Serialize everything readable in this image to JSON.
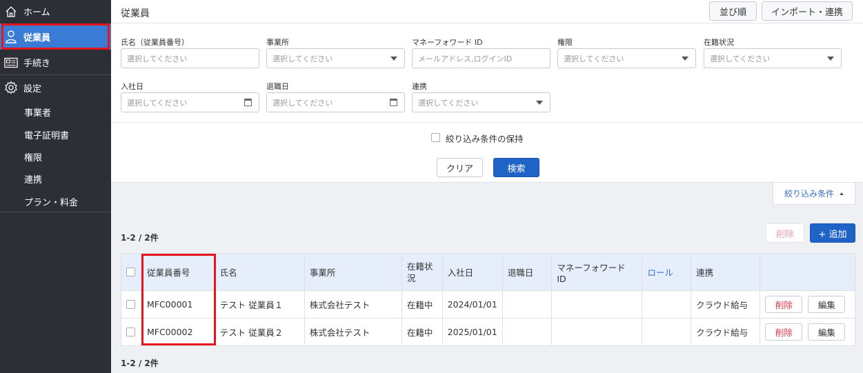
{
  "sidebar": {
    "items": [
      {
        "label": "ホーム",
        "icon": "home-icon"
      },
      {
        "label": "従業員",
        "icon": "person-icon",
        "active": true
      },
      {
        "label": "手続き",
        "icon": "form-icon"
      },
      {
        "label": "設定",
        "icon": "gear-icon"
      }
    ],
    "sub_items": [
      "事業者",
      "電子証明書",
      "権限",
      "連携",
      "プラン・料金"
    ]
  },
  "header": {
    "title": "従業員",
    "sort_label": "並び順",
    "import_label": "インポート・連携"
  },
  "filters": {
    "name": {
      "label": "氏名（従業員番号）",
      "placeholder": "選択してください"
    },
    "office": {
      "label": "事業所",
      "placeholder": "選択してください"
    },
    "mfid": {
      "label": "マネーフォワード ID",
      "placeholder": "メールアドレス,ログインID"
    },
    "permission": {
      "label": "権限",
      "placeholder": "選択してください"
    },
    "status": {
      "label": "在籍状況",
      "placeholder": "選択してください"
    },
    "join_date": {
      "label": "入社日",
      "placeholder": "選択してください"
    },
    "leave_date": {
      "label": "退職日",
      "placeholder": "選択してください"
    },
    "link": {
      "label": "連携",
      "placeholder": "選択してください"
    },
    "keep_label": "絞り込み条件の保持",
    "clear_label": "クリア",
    "search_label": "検索",
    "toggle_label": "絞り込み条件"
  },
  "list": {
    "count_top": "1-2 / 2件",
    "count_bottom": "1-2 / 2件",
    "delete_label": "削除",
    "add_label": "+ 追加",
    "columns": [
      "従業員番号",
      "氏名",
      "事業所",
      "在籍状況",
      "入社日",
      "退職日",
      "マネーフォワード ID",
      "ロール",
      "連携"
    ],
    "rows": [
      {
        "id": "MFC00001",
        "name": "テスト 従業員１",
        "office": "株式会社テスト",
        "status": "在籍中",
        "join": "2024/01/01",
        "leave": "",
        "mfid": "",
        "role": "",
        "link": "クラウド給与",
        "delete": "削除",
        "edit": "編集"
      },
      {
        "id": "MFC00002",
        "name": "テスト 従業員２",
        "office": "株式会社テスト",
        "status": "在籍中",
        "join": "2025/01/01",
        "leave": "",
        "mfid": "",
        "role": "",
        "link": "クラウド給与",
        "delete": "削除",
        "edit": "編集"
      }
    ]
  },
  "colors": {
    "sidebar_bg": "#2c3036",
    "active_nav": "#3a7bd5",
    "primary": "#1f63c6",
    "highlight": "#e8141b",
    "header_row": "#e6eefb",
    "danger_text": "#d9364a"
  }
}
